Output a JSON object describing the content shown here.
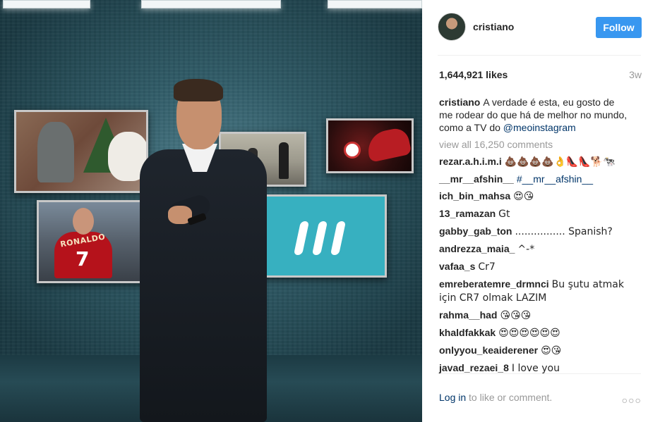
{
  "post": {
    "username": "cristiano",
    "follow_label": "Follow",
    "likes": "1,644,921 likes",
    "time_ago": "3w",
    "caption_user": "cristiano",
    "caption_text": "A verdade é esta, eu gosto de me rodear do que há de melhor no mundo, como a TV do",
    "caption_mention": "@meoinstagram",
    "view_all": "view all 16,250 comments",
    "scene_labels": {
      "jersey_name": "RONALDO",
      "jersey_number": "7"
    }
  },
  "comments": [
    {
      "user": "rezar.a.h.i.m.i",
      "text": "💩💩💩💩👌👠👠🐕🐄",
      "mention": ""
    },
    {
      "user": "__mr__afshin__",
      "text": "",
      "mention": "#__mr__afshin__"
    },
    {
      "user": "ich_bin_mahsa",
      "text": "😍😘",
      "mention": ""
    },
    {
      "user": "13_ramazan",
      "text": "Gt",
      "mention": ""
    },
    {
      "user": "gabby_gab_ton",
      "text": "................ Spanish?",
      "mention": ""
    },
    {
      "user": "andrezza_maia_",
      "text": "^-*",
      "mention": ""
    },
    {
      "user": "vafaa_s",
      "text": "Cr7",
      "mention": ""
    },
    {
      "user": "emreberatemre_drmnci",
      "text": "Bu şutu atmak için CR7 olmak LAZIM",
      "mention": ""
    },
    {
      "user": "rahma__had",
      "text": "😘😘😘",
      "mention": ""
    },
    {
      "user": "khaldfakkak",
      "text": "😍😍😍😍😍😍",
      "mention": ""
    },
    {
      "user": "onlyyou_keaiderener",
      "text": "😍😘",
      "mention": ""
    },
    {
      "user": "javad_rezaei_8",
      "text": "I love you",
      "mention": ""
    }
  ],
  "footer": {
    "login_link": "Log in",
    "login_text": "to like or comment.",
    "more_icon": "ellipsis-icon"
  },
  "colors": {
    "accent": "#3897f0",
    "link": "#003569",
    "muted": "#999999"
  }
}
